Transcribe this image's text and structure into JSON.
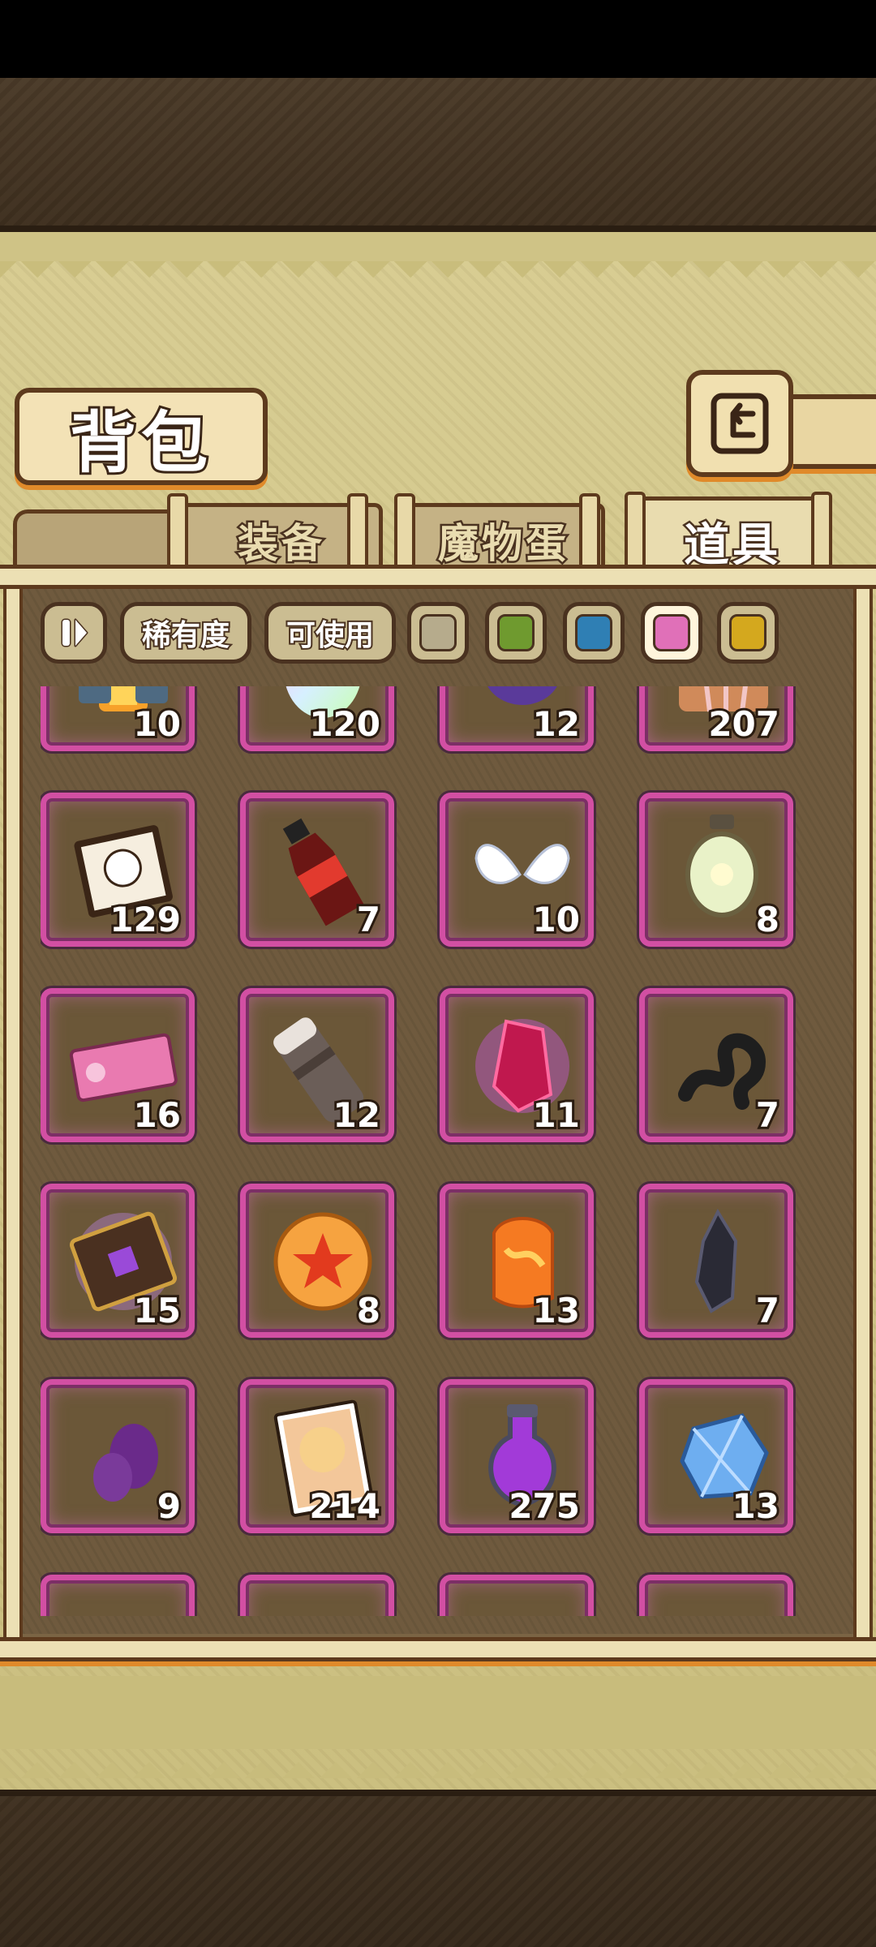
{
  "title": "背包",
  "tabs": [
    {
      "label": "装备",
      "active": false
    },
    {
      "label": "魔物蛋",
      "active": false
    },
    {
      "label": "道具",
      "active": true
    }
  ],
  "filters": {
    "rarity_label": "稀有度",
    "usable_label": "可使用",
    "color_swatches": [
      {
        "name": "gray",
        "color": "#b6ab8c",
        "selected": false
      },
      {
        "name": "green",
        "color": "#6f9a2f",
        "selected": false
      },
      {
        "name": "blue",
        "color": "#2f7fb4",
        "selected": false
      },
      {
        "name": "pink",
        "color": "#e070b8",
        "selected": true
      },
      {
        "name": "yellow",
        "color": "#d4a81e",
        "selected": false
      }
    ]
  },
  "items": [
    {
      "icon": "lantern-machine-icon",
      "count": "10"
    },
    {
      "icon": "rainbow-egg-icon",
      "count": "120"
    },
    {
      "icon": "purple-monster-icon",
      "count": "12"
    },
    {
      "icon": "picnic-basket-icon",
      "count": "207"
    },
    {
      "icon": "sketch-card-icon",
      "count": "129"
    },
    {
      "icon": "cola-bottle-icon",
      "count": "7"
    },
    {
      "icon": "angel-wings-icon",
      "count": "10"
    },
    {
      "icon": "lantern-icon",
      "count": "8"
    },
    {
      "icon": "ticket-icon",
      "count": "16"
    },
    {
      "icon": "thermos-icon",
      "count": "12"
    },
    {
      "icon": "red-crystal-icon",
      "count": "11"
    },
    {
      "icon": "dark-tentacle-icon",
      "count": "7"
    },
    {
      "icon": "spell-book-icon",
      "count": "15"
    },
    {
      "icon": "star-orb-icon",
      "count": "8"
    },
    {
      "icon": "amber-stone-icon",
      "count": "13"
    },
    {
      "icon": "black-crystal-icon",
      "count": "7"
    },
    {
      "icon": "purple-egg-icon",
      "count": "9"
    },
    {
      "icon": "character-card-icon",
      "count": "214"
    },
    {
      "icon": "purple-potion-icon",
      "count": "275"
    },
    {
      "icon": "blue-gem-icon",
      "count": "13"
    },
    {
      "icon": "item-icon",
      "count": ""
    },
    {
      "icon": "item-icon",
      "count": ""
    },
    {
      "icon": "item-icon",
      "count": ""
    },
    {
      "icon": "item-icon",
      "count": ""
    }
  ]
}
